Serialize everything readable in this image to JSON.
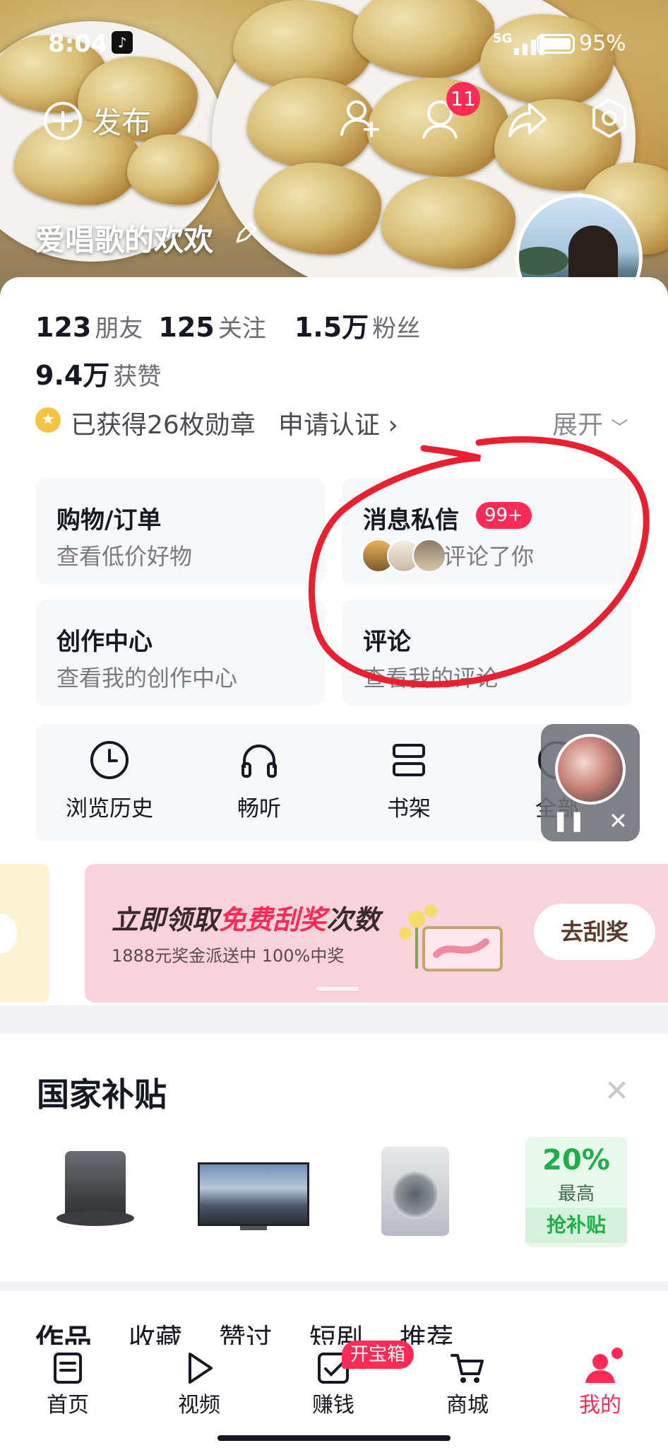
{
  "status_bar": {
    "time": "8:04",
    "network": "5G",
    "battery": "95%"
  },
  "header": {
    "publish_label": "发布",
    "notification_count": "11",
    "username": "爱唱歌的欢欢"
  },
  "stats": {
    "friends_num": "123",
    "friends_label": "朋友",
    "following_num": "125",
    "following_label": "关注",
    "fans_num": "1.5万",
    "fans_label": "粉丝",
    "likes_num": "9.4万",
    "likes_label": "获赞"
  },
  "badges": {
    "earned_text": "已获得26枚勋章",
    "verify_text": "申请认证 ›",
    "expand_text": "展开"
  },
  "tiles": [
    {
      "title": "购物/订单",
      "subtitle": "查看低价好物"
    },
    {
      "title": "消息私信",
      "badge": "99+",
      "subtitle": "评论了你"
    },
    {
      "title": "创作中心",
      "subtitle": "查看我的创作中心"
    },
    {
      "title": "评论",
      "subtitle": "查看我的评论"
    }
  ],
  "tools": [
    {
      "label": "浏览历史",
      "icon": "clock-icon"
    },
    {
      "label": "畅听",
      "icon": "headphones-icon"
    },
    {
      "label": "书架",
      "icon": "bookshelf-icon"
    },
    {
      "label": "全部",
      "icon": "grid-icon"
    }
  ],
  "banner": {
    "title_prefix": "立即领取",
    "title_highlight": "免费刮奖",
    "title_suffix": "次数",
    "subtitle": "1888元奖金派送中 100%中奖",
    "button": "去刮奖"
  },
  "subsidy": {
    "title": "国家补贴",
    "percent": "20%",
    "percent_label": "最高",
    "cta": "抢补贴"
  },
  "content_tabs": [
    "作品",
    "收藏",
    "赞过",
    "短剧",
    "推荐"
  ],
  "bottom_nav": [
    {
      "label": "首页",
      "icon": "home-doc-icon"
    },
    {
      "label": "视频",
      "icon": "play-icon"
    },
    {
      "label": "赚钱",
      "icon": "checkbox-icon",
      "badge": "开宝箱"
    },
    {
      "label": "商城",
      "icon": "cart-icon"
    },
    {
      "label": "我的",
      "icon": "person-icon"
    }
  ],
  "colors": {
    "accent_red": "#fe2c55",
    "annotation_red": "#e8202f",
    "banner_pink": "#f9d3dc"
  }
}
